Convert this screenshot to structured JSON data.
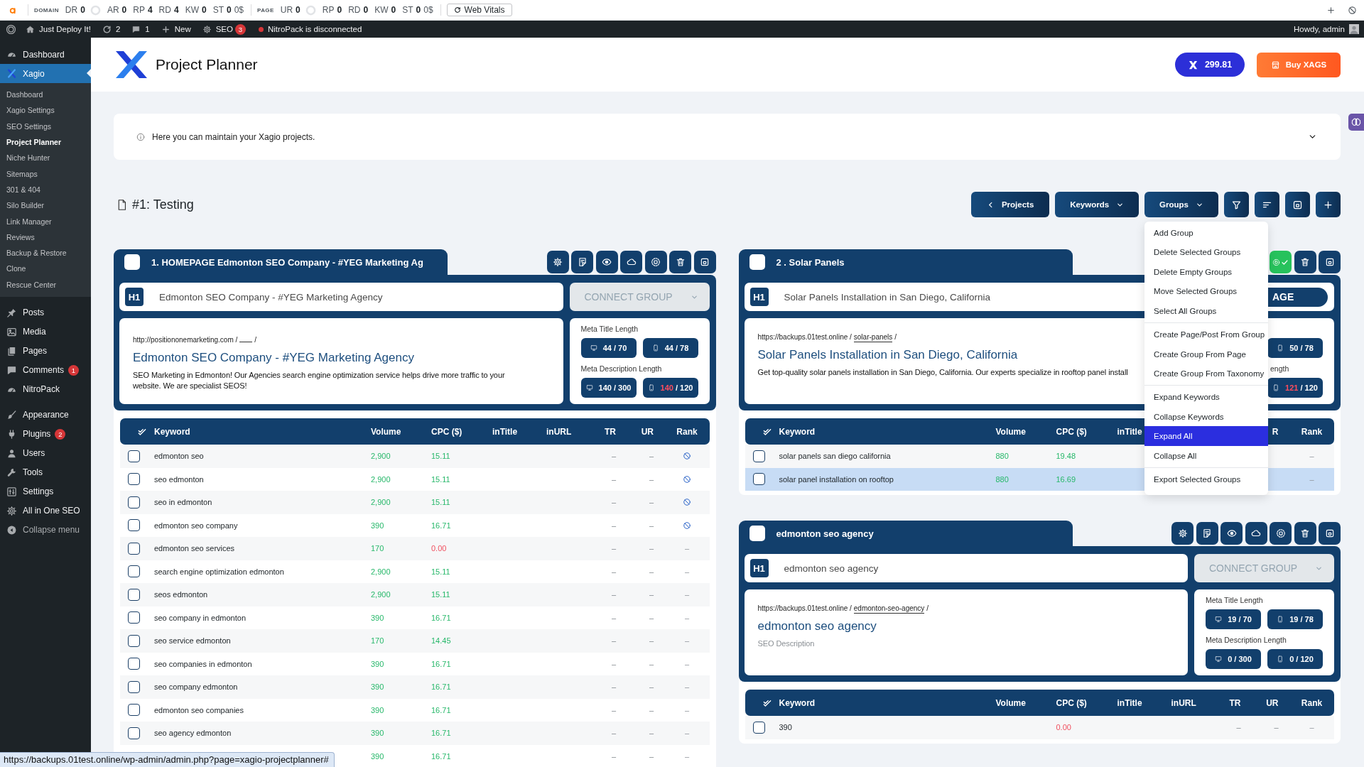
{
  "seo_bar": {
    "domain_label": "DOMAIN",
    "domain_metrics": [
      {
        "label": "DR",
        "value": "0",
        "ring": true
      },
      {
        "label": "AR",
        "value": "0",
        "ring": false
      },
      {
        "label": "RP",
        "value": "4",
        "ring": false
      },
      {
        "label": "RD",
        "value": "4",
        "ring": false
      },
      {
        "label": "KW",
        "value": "0",
        "ring": false
      },
      {
        "label": "ST",
        "value": "0",
        "extra": "0$",
        "ring": false
      }
    ],
    "page_label": "PAGE",
    "page_metrics": [
      {
        "label": "UR",
        "value": "0",
        "ring": true
      },
      {
        "label": "RP",
        "value": "0",
        "ring": false
      },
      {
        "label": "RD",
        "value": "0",
        "ring": false
      },
      {
        "label": "KW",
        "value": "0",
        "ring": false
      },
      {
        "label": "ST",
        "value": "0",
        "extra": "0$",
        "ring": false
      }
    ],
    "web_vitals": "Web Vitals"
  },
  "admin_bar": {
    "site": "Just Deploy It!",
    "updates": "2",
    "comments": "1",
    "new": "New",
    "seo": "SEO",
    "seo_badge": "3",
    "notice": "NitroPack is disconnected",
    "account": "Howdy, admin"
  },
  "sidebar": {
    "sections": [
      [
        {
          "kind": "dashboard",
          "label": "Dashboard",
          "selected": false
        },
        {
          "kind": "xagio",
          "label": "Xagio",
          "selected": true,
          "children": [
            {
              "label": "Dashboard",
              "selected": false
            },
            {
              "label": "Xagio Settings",
              "selected": false
            },
            {
              "label": "SEO Settings",
              "selected": false
            },
            {
              "label": "Project Planner",
              "selected": true
            },
            {
              "label": "Niche Hunter",
              "selected": false
            },
            {
              "label": "Sitemaps",
              "selected": false
            },
            {
              "label": "301 & 404",
              "selected": false
            },
            {
              "label": "Silo Builder",
              "selected": false
            },
            {
              "label": "Link Manager",
              "selected": false
            },
            {
              "label": "Reviews",
              "selected": false
            },
            {
              "label": "Backup & Restore",
              "selected": false
            },
            {
              "label": "Clone",
              "selected": false
            },
            {
              "label": "Rescue Center",
              "selected": false
            }
          ]
        }
      ],
      [
        {
          "kind": "posts",
          "label": "Posts",
          "selected": false
        },
        {
          "kind": "media",
          "label": "Media",
          "selected": false
        },
        {
          "kind": "pages",
          "label": "Pages",
          "selected": false
        },
        {
          "kind": "comments",
          "label": "Comments",
          "badge": "1",
          "selected": false
        },
        {
          "kind": "nitropack",
          "label": "NitroPack",
          "selected": false
        }
      ],
      [
        {
          "kind": "appearance",
          "label": "Appearance",
          "selected": false
        },
        {
          "kind": "plugins",
          "label": "Plugins",
          "badge": "2",
          "selected": false
        },
        {
          "kind": "users",
          "label": "Users",
          "selected": false
        },
        {
          "kind": "tools",
          "label": "Tools",
          "selected": false
        },
        {
          "kind": "settings",
          "label": "Settings",
          "selected": false
        },
        {
          "kind": "aioseo",
          "label": "All in One SEO",
          "selected": false
        },
        {
          "kind": "collapse",
          "label": "Collapse menu",
          "selected": false
        }
      ]
    ]
  },
  "header": {
    "title": "Project Planner",
    "balance": "299.81",
    "buy": "Buy XAGS"
  },
  "info": {
    "text": "Here you can maintain your Xagio projects."
  },
  "project": {
    "title": "#1: Testing",
    "toolbar": [
      {
        "kind": "back",
        "label": "Projects"
      },
      {
        "kind": "dropdown",
        "label": "Keywords"
      },
      {
        "kind": "dropdown",
        "label": "Groups",
        "menu": [
          [
            {
              "label": "Add Group",
              "selected": false
            },
            {
              "label": "Delete Selected Groups",
              "selected": false
            },
            {
              "label": "Delete Empty Groups",
              "selected": false
            },
            {
              "label": "Move Selected Groups",
              "selected": false
            },
            {
              "label": "Select All Groups",
              "selected": false
            }
          ],
          [
            {
              "label": "Create Page/Post From Group",
              "selected": false
            },
            {
              "label": "Create Group From Page",
              "selected": false
            },
            {
              "label": "Create Group From Taxonomy",
              "selected": false
            }
          ],
          [
            {
              "label": "Expand Keywords",
              "selected": false
            },
            {
              "label": "Collapse Keywords",
              "selected": false
            },
            {
              "label": "Expand All",
              "selected": true
            },
            {
              "label": "Collapse All",
              "selected": false
            }
          ],
          [
            {
              "label": "Export Selected Groups",
              "selected": false
            }
          ]
        ]
      },
      {
        "kind": "filter"
      },
      {
        "kind": "sort"
      },
      {
        "kind": "save"
      },
      {
        "kind": "add"
      }
    ]
  },
  "group_columns": [
    [
      {
        "title": "1. HOMEPAGE Edmonton SEO Company - #YEG Marketing Ag",
        "checked": false,
        "actions": [
          {
            "kind": "settings"
          },
          {
            "kind": "notes"
          },
          {
            "kind": "preview"
          },
          {
            "kind": "cloud"
          },
          {
            "kind": "ai",
            "done": false
          },
          {
            "kind": "delete"
          },
          {
            "kind": "save"
          }
        ],
        "h1": {
          "tag": "H1",
          "text": "Edmonton SEO Company - #YEG Marketing Agency"
        },
        "connect": {
          "kind": "group",
          "label": "CONNECT GROUP"
        },
        "url": {
          "base": "http://positiononemarketing.com /",
          "suffix": "/"
        },
        "seo_title": "Edmonton SEO Company - #YEG Marketing Agency",
        "description": {
          "value": "SEO Marketing in Edmonton! Our Agencies search engine optimization service helps drive more traffic to your website. We are specialist SEOS!"
        },
        "meta": [
          {
            "label": "Meta Title Length",
            "chips": [
              {
                "kind": "desktop",
                "count": "44",
                "limit": "/ 70",
                "over": false
              },
              {
                "kind": "mobile",
                "count": "44",
                "limit": "/ 78",
                "over": false
              }
            ]
          },
          {
            "label": "Meta Description Length",
            "chips": [
              {
                "kind": "desktop",
                "count": "140",
                "limit": "/ 300",
                "over": false
              },
              {
                "kind": "mobile",
                "count": "140",
                "limit": "/ 120",
                "over": true
              }
            ]
          }
        ],
        "columns": [
          {
            "kind": "keyword",
            "label": "Keyword"
          },
          {
            "kind": "volume",
            "label": "Volume"
          },
          {
            "kind": "cpc",
            "label": "CPC ($)"
          },
          {
            "kind": "intitle",
            "label": "inTitle"
          },
          {
            "kind": "inurl",
            "label": "inURL"
          },
          {
            "kind": "tr",
            "label": "TR"
          },
          {
            "kind": "ur",
            "label": "UR"
          },
          {
            "kind": "rank",
            "label": "Rank"
          }
        ],
        "rows": [
          {
            "checked": false,
            "selected": false,
            "keyword": "edmonton seo",
            "volume": "2,900",
            "cpc": "15.11",
            "cpc_alert": false,
            "tr": "–",
            "ur": "–",
            "rank": {
              "kind": "icon"
            }
          },
          {
            "checked": false,
            "selected": false,
            "keyword": "seo edmonton",
            "volume": "2,900",
            "cpc": "15.11",
            "cpc_alert": false,
            "tr": "–",
            "ur": "–",
            "rank": {
              "kind": "icon"
            }
          },
          {
            "checked": false,
            "selected": false,
            "keyword": "seo in edmonton",
            "volume": "2,900",
            "cpc": "15.11",
            "cpc_alert": false,
            "tr": "–",
            "ur": "–",
            "rank": {
              "kind": "icon"
            }
          },
          {
            "checked": false,
            "selected": false,
            "keyword": "edmonton seo company",
            "volume": "390",
            "cpc": "16.71",
            "cpc_alert": false,
            "tr": "–",
            "ur": "–",
            "rank": {
              "kind": "icon"
            }
          },
          {
            "checked": false,
            "selected": false,
            "keyword": "edmonton seo services",
            "volume": "170",
            "cpc": "0.00",
            "cpc_alert": true,
            "tr": "–",
            "ur": "–",
            "rank": {
              "kind": "text",
              "text": "–"
            }
          },
          {
            "checked": false,
            "selected": false,
            "keyword": "search engine optimization edmonton",
            "volume": "2,900",
            "cpc": "15.11",
            "cpc_alert": false,
            "tr": "–",
            "ur": "–",
            "rank": {
              "kind": "text",
              "text": "–"
            }
          },
          {
            "checked": false,
            "selected": false,
            "keyword": "seos edmonton",
            "volume": "2,900",
            "cpc": "15.11",
            "cpc_alert": false,
            "tr": "–",
            "ur": "–",
            "rank": {
              "kind": "text",
              "text": "–"
            }
          },
          {
            "checked": false,
            "selected": false,
            "keyword": "seo company in edmonton",
            "volume": "390",
            "cpc": "16.71",
            "cpc_alert": false,
            "tr": "–",
            "ur": "–",
            "rank": {
              "kind": "text",
              "text": "–"
            }
          },
          {
            "checked": false,
            "selected": false,
            "keyword": "seo service edmonton",
            "volume": "170",
            "cpc": "14.45",
            "cpc_alert": false,
            "tr": "–",
            "ur": "–",
            "rank": {
              "kind": "text",
              "text": "–"
            }
          },
          {
            "checked": false,
            "selected": false,
            "keyword": "seo companies in edmonton",
            "volume": "390",
            "cpc": "16.71",
            "cpc_alert": false,
            "tr": "–",
            "ur": "–",
            "rank": {
              "kind": "text",
              "text": "–"
            }
          },
          {
            "checked": false,
            "selected": false,
            "keyword": "seo company edmonton",
            "volume": "390",
            "cpc": "16.71",
            "cpc_alert": false,
            "tr": "–",
            "ur": "–",
            "rank": {
              "kind": "text",
              "text": "–"
            }
          },
          {
            "checked": false,
            "selected": false,
            "keyword": "edmonton seo companies",
            "volume": "390",
            "cpc": "16.71",
            "cpc_alert": false,
            "tr": "–",
            "ur": "–",
            "rank": {
              "kind": "text",
              "text": "–"
            }
          },
          {
            "checked": false,
            "selected": false,
            "keyword": "seo agency edmonton",
            "volume": "390",
            "cpc": "16.71",
            "cpc_alert": false,
            "tr": "–",
            "ur": "–",
            "rank": {
              "kind": "text",
              "text": "–"
            }
          },
          {
            "selected": false,
            "volume": "390",
            "cpc": "16.71",
            "cpc_alert": false,
            "tr": "–",
            "ur": "–",
            "rank": {
              "kind": "text",
              "text": "–"
            }
          }
        ]
      }
    ],
    [
      {
        "title": "2 . Solar Panels",
        "checked": false,
        "actions": [
          {
            "kind": "ai",
            "done": true
          },
          {
            "kind": "delete"
          },
          {
            "kind": "save"
          }
        ],
        "h1": {
          "tag": "H1",
          "text": "Solar Panels Installation in San Diego, California"
        },
        "connect": {
          "kind": "page",
          "label": "AGE"
        },
        "url": {
          "base": "https://backups.01test.online /",
          "slug": "solar-panels",
          "suffix": "/"
        },
        "seo_title": "Solar Panels Installation in San Diego, California",
        "description": {
          "value": "Get top-quality solar panels installation in San Diego, California. Our experts specialize in rooftop panel install"
        },
        "meta": [
          {
            "chips": [
              {
                "kind": "mobile",
                "count": "50",
                "limit": "/ 78",
                "over": false
              }
            ]
          },
          {
            "label": "ength",
            "chips": [
              {
                "kind": "mobile",
                "count": "121",
                "limit": "/ 120",
                "over": true
              }
            ]
          }
        ],
        "columns": [
          {
            "kind": "keyword",
            "label": "Keyword"
          },
          {
            "kind": "volume",
            "label": "Volume"
          },
          {
            "kind": "cpc",
            "label": "CPC ($)"
          },
          {
            "kind": "intitle",
            "label": "inTitle"
          },
          {
            "kind": "ur",
            "label": "R"
          },
          {
            "kind": "rank",
            "label": "Rank"
          }
        ],
        "rows": [
          {
            "checked": false,
            "selected": false,
            "keyword": "solar panels san diego california",
            "volume": "880",
            "cpc": "19.48",
            "cpc_alert": false,
            "rank": {
              "kind": "text",
              "text": "–"
            }
          },
          {
            "checked": false,
            "selected": true,
            "keyword": "solar panel installation on rooftop",
            "volume": "880",
            "cpc": "16.69",
            "cpc_alert": false,
            "rank": {
              "kind": "text",
              "text": "–"
            }
          }
        ]
      },
      {
        "title": "edmonton seo agency",
        "checked": false,
        "actions": [
          {
            "kind": "settings"
          },
          {
            "kind": "notes"
          },
          {
            "kind": "preview"
          },
          {
            "kind": "cloud"
          },
          {
            "kind": "ai",
            "done": false
          },
          {
            "kind": "delete"
          },
          {
            "kind": "save"
          }
        ],
        "h1": {
          "tag": "H1",
          "text": "edmonton seo agency"
        },
        "connect": {
          "kind": "group",
          "label": "CONNECT GROUP"
        },
        "url": {
          "base": "https://backups.01test.online /",
          "slug": "edmonton-seo-agency",
          "suffix": "/"
        },
        "seo_title": "edmonton seo agency",
        "description": {
          "placeholder": "SEO Description"
        },
        "meta": [
          {
            "label": "Meta Title Length",
            "chips": [
              {
                "kind": "desktop",
                "count": "19",
                "limit": "/ 70",
                "over": false
              },
              {
                "kind": "mobile",
                "count": "19",
                "limit": "/ 78",
                "over": false
              }
            ]
          },
          {
            "label": "Meta Description Length",
            "chips": [
              {
                "kind": "desktop",
                "count": "0",
                "limit": "/ 300",
                "over": false
              },
              {
                "kind": "mobile",
                "count": "0",
                "limit": "/ 120",
                "over": false
              }
            ]
          }
        ],
        "columns": [
          {
            "kind": "keyword",
            "label": "Keyword"
          },
          {
            "kind": "volume",
            "label": "Volume"
          },
          {
            "kind": "cpc",
            "label": "CPC ($)"
          },
          {
            "kind": "intitle",
            "label": "inTitle"
          },
          {
            "kind": "inurl",
            "label": "inURL"
          },
          {
            "kind": "tr",
            "label": "TR"
          },
          {
            "kind": "ur",
            "label": "UR"
          },
          {
            "kind": "rank",
            "label": "Rank"
          }
        ],
        "rows": [
          {
            "checked": false,
            "selected": false,
            "keyword": "390",
            "cpc": "0.00",
            "cpc_alert": true,
            "tr": "–",
            "ur": "–",
            "rank": {
              "kind": "text",
              "text": "–"
            }
          }
        ]
      }
    ]
  ],
  "status_url": "https://backups.01test.online/wp-admin/admin.php?page=xagio-projectplanner#"
}
